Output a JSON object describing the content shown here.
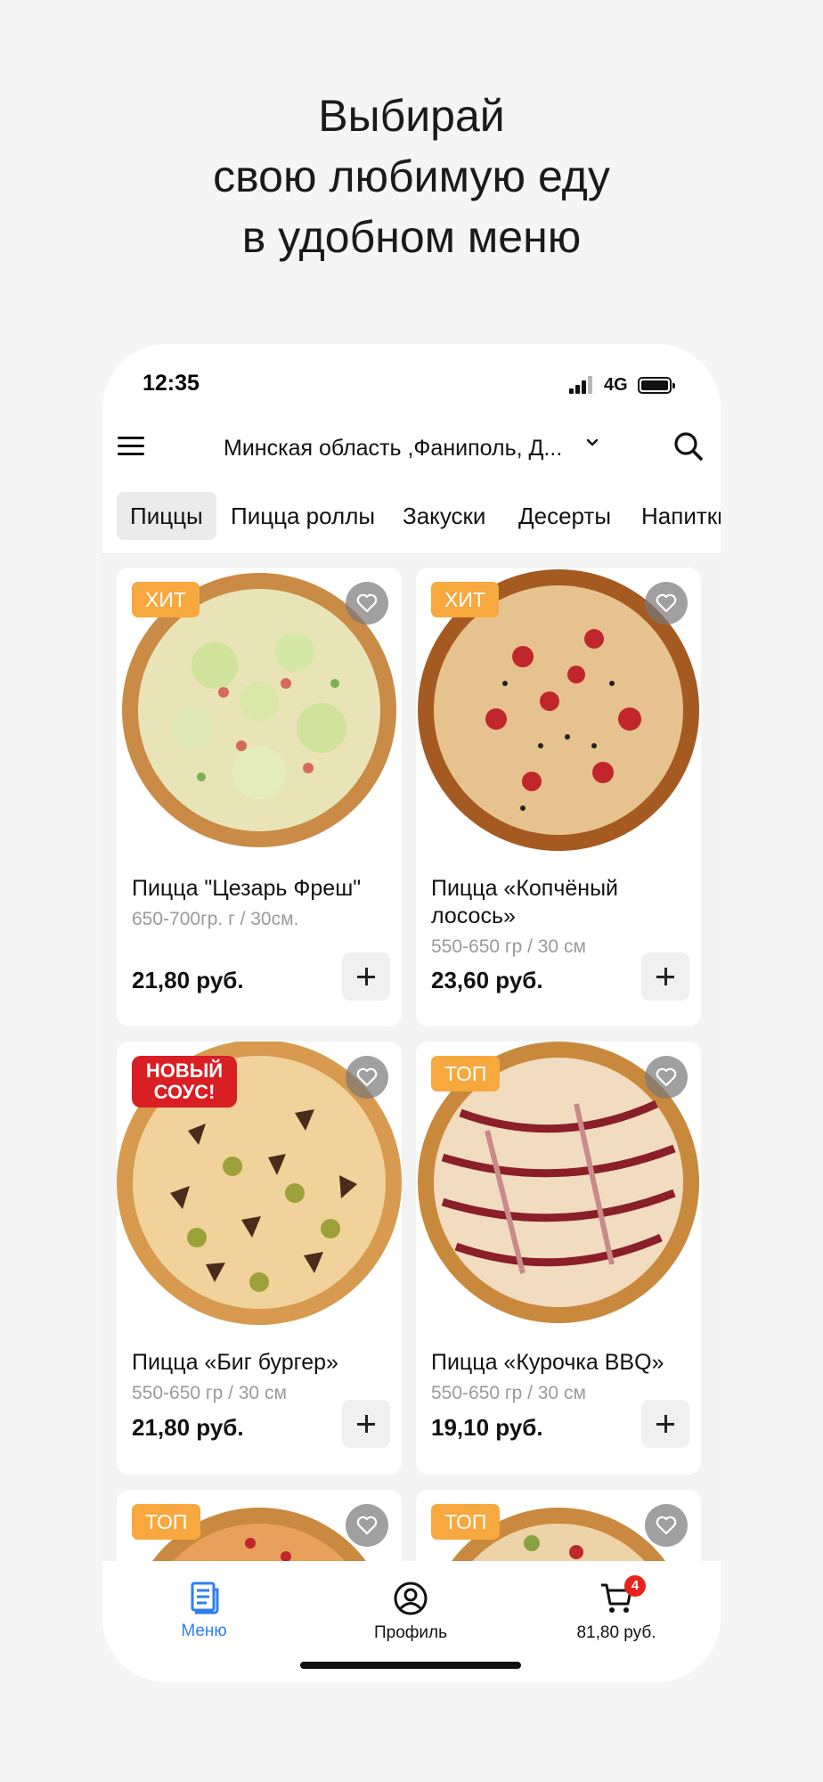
{
  "headline": {
    "line1": "Выбирай",
    "line2": "свою любимую еду",
    "line3": "в удобном меню"
  },
  "status": {
    "time": "12:35",
    "network": "4G"
  },
  "header": {
    "location": "Минская область ,Фаниполь, Д...",
    "menu_icon": "hamburger-icon",
    "search_icon": "search-icon"
  },
  "tabs": [
    {
      "label": "Пиццы",
      "active": true
    },
    {
      "label": "Пицца роллы"
    },
    {
      "label": "Закуски"
    },
    {
      "label": "Десерты"
    },
    {
      "label": "Напитки"
    }
  ],
  "products": [
    {
      "badge": "ХИТ",
      "title": "Пицца \"Цезарь Фреш\"",
      "weight": "650-700гр. г / 30см.",
      "price": "21,80 руб."
    },
    {
      "badge": "ХИТ",
      "title": "Пицца «Копчёный лосось»",
      "weight": "550-650 гр / 30 см",
      "price": "23,60 руб."
    },
    {
      "badge": "НОВЫЙ СОУС!",
      "title": "Пицца «Биг бургер»",
      "weight": "550-650 гр / 30 см",
      "price": "21,80 руб."
    },
    {
      "badge": "ТОП",
      "title": "Пицца «Курочка BBQ»",
      "weight": "550-650 гр / 30 см",
      "price": "19,10 руб."
    },
    {
      "badge": "ТОП"
    },
    {
      "badge": "ТОП"
    }
  ],
  "nav": {
    "menu_label": "Меню",
    "profile_label": "Профиль",
    "cart_total": "81,80 руб.",
    "cart_count": "4"
  },
  "colors": {
    "accent_blue": "#2d7ff0",
    "badge_orange": "#f7a83e",
    "badge_red": "#d91e24",
    "cart_badge": "#e8231f"
  }
}
